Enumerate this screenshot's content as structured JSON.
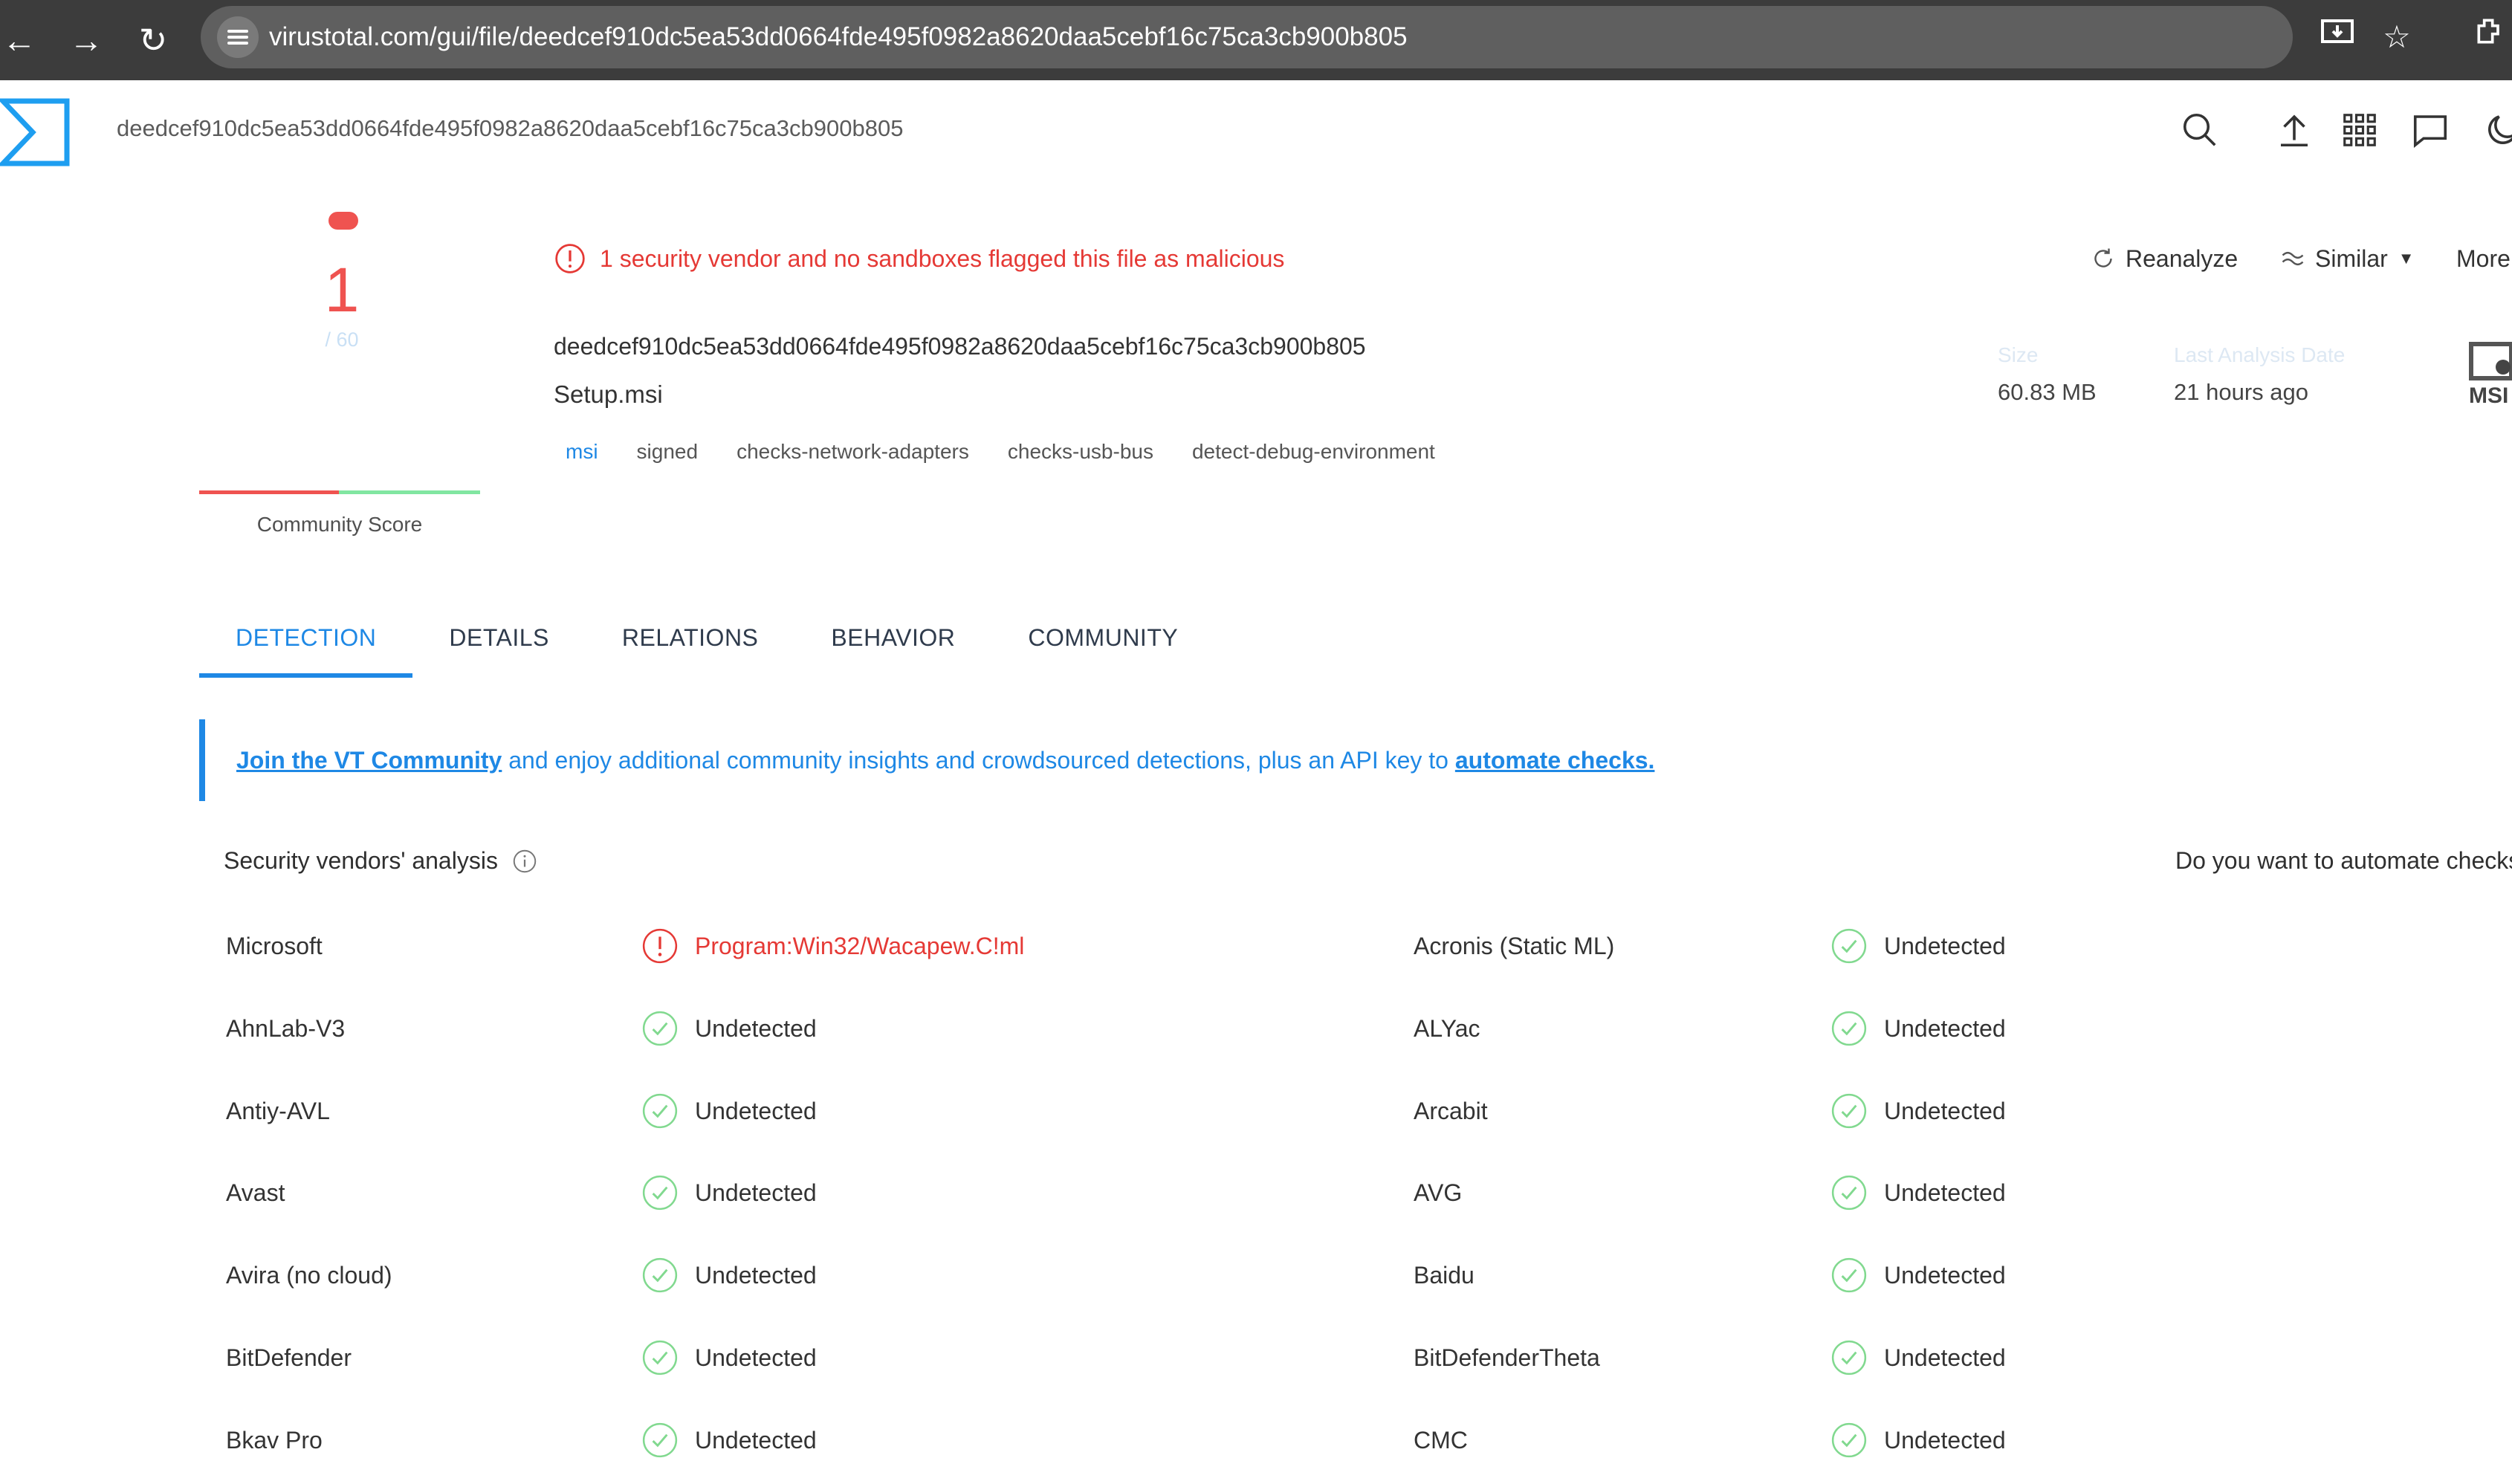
{
  "browser": {
    "url": "virustotal.com/gui/file/deedcef910dc5ea53dd0664fde495f0982a8620daa5cebf16c75ca3cb900b805"
  },
  "header": {
    "hash": "deedcef910dc5ea53dd0664fde495f0982a8620daa5cebf16c75ca3cb900b805"
  },
  "score": {
    "detections": "1",
    "total": "/ 60",
    "community_label": "Community Score",
    "colors": {
      "malicious": "#ef5350",
      "harmless": "#81e6a1"
    }
  },
  "alert": {
    "text": "1 security vendor and no sandboxes flagged this file as malicious"
  },
  "file": {
    "hash": "deedcef910dc5ea53dd0664fde495f0982a8620daa5cebf16c75ca3cb900b805",
    "name": "Setup.msi",
    "tags": [
      "msi",
      "signed",
      "checks-network-adapters",
      "checks-usb-bus",
      "detect-debug-environment"
    ]
  },
  "actions": {
    "reanalyze": "Reanalyze",
    "similar": "Similar",
    "more": "More"
  },
  "stats": {
    "size_label": "Size",
    "size_value": "60.83 MB",
    "date_label": "Last Analysis Date",
    "date_value": "21 hours ago",
    "file_type": "MSI"
  },
  "tabs": [
    "DETECTION",
    "DETAILS",
    "RELATIONS",
    "BEHAVIOR",
    "COMMUNITY"
  ],
  "banner": {
    "link1": "Join the VT Community",
    "middle": " and enjoy additional community insights and crowdsourced detections, plus an API key to ",
    "link2": "automate checks."
  },
  "vendors": {
    "title": "Security vendors' analysis",
    "automate": "Do you want to automate checks?",
    "rows": [
      {
        "left": {
          "name": "Microsoft",
          "result": "Program:Win32/Wacapew.C!ml",
          "malicious": true
        },
        "right": {
          "name": "Acronis (Static ML)",
          "result": "Undetected",
          "malicious": false
        }
      },
      {
        "left": {
          "name": "AhnLab-V3",
          "result": "Undetected",
          "malicious": false
        },
        "right": {
          "name": "ALYac",
          "result": "Undetected",
          "malicious": false
        }
      },
      {
        "left": {
          "name": "Antiy-AVL",
          "result": "Undetected",
          "malicious": false
        },
        "right": {
          "name": "Arcabit",
          "result": "Undetected",
          "malicious": false
        }
      },
      {
        "left": {
          "name": "Avast",
          "result": "Undetected",
          "malicious": false
        },
        "right": {
          "name": "AVG",
          "result": "Undetected",
          "malicious": false
        }
      },
      {
        "left": {
          "name": "Avira (no cloud)",
          "result": "Undetected",
          "malicious": false
        },
        "right": {
          "name": "Baidu",
          "result": "Undetected",
          "malicious": false
        }
      },
      {
        "left": {
          "name": "BitDefender",
          "result": "Undetected",
          "malicious": false
        },
        "right": {
          "name": "BitDefenderTheta",
          "result": "Undetected",
          "malicious": false
        }
      },
      {
        "left": {
          "name": "Bkav Pro",
          "result": "Undetected",
          "malicious": false
        },
        "right": {
          "name": "CMC",
          "result": "Undetected",
          "malicious": false
        }
      }
    ]
  }
}
